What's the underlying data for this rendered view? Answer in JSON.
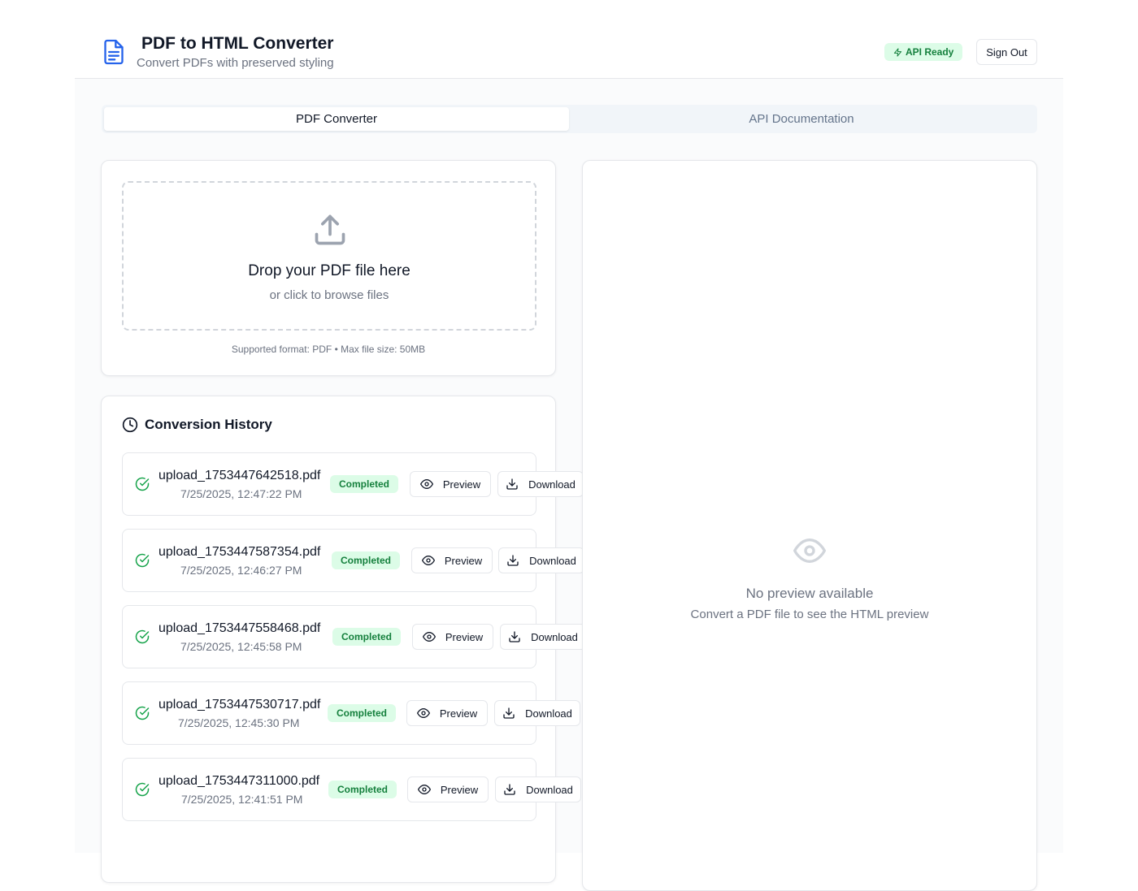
{
  "header": {
    "title": "PDF to HTML Converter",
    "subtitle": "Convert PDFs with preserved styling",
    "api_status": "API Ready",
    "sign_out_label": "Sign Out"
  },
  "tabs": [
    {
      "label": "PDF Converter",
      "active": true
    },
    {
      "label": "API Documentation",
      "active": false
    }
  ],
  "upload": {
    "title": "Drop your PDF file here",
    "subtitle": "or click to browse files",
    "note": "Supported format: PDF • Max file size: 50MB"
  },
  "history": {
    "title": "Conversion History",
    "preview_label": "Preview",
    "download_label": "Download",
    "items": [
      {
        "filename": "upload_1753447642518.pdf",
        "date": "7/25/2025, 12:47:22 PM",
        "status": "Completed"
      },
      {
        "filename": "upload_1753447587354.pdf",
        "date": "7/25/2025, 12:46:27 PM",
        "status": "Completed"
      },
      {
        "filename": "upload_1753447558468.pdf",
        "date": "7/25/2025, 12:45:58 PM",
        "status": "Completed"
      },
      {
        "filename": "upload_1753447530717.pdf",
        "date": "7/25/2025, 12:45:30 PM",
        "status": "Completed"
      },
      {
        "filename": "upload_1753447311000.pdf",
        "date": "7/25/2025, 12:41:51 PM",
        "status": "Completed"
      }
    ]
  },
  "preview": {
    "empty_title": "No preview available",
    "empty_subtitle": "Convert a PDF file to see the HTML preview"
  },
  "colors": {
    "accent": "#2563eb",
    "success": "#16a34a",
    "success_bg": "#dcfce7"
  }
}
